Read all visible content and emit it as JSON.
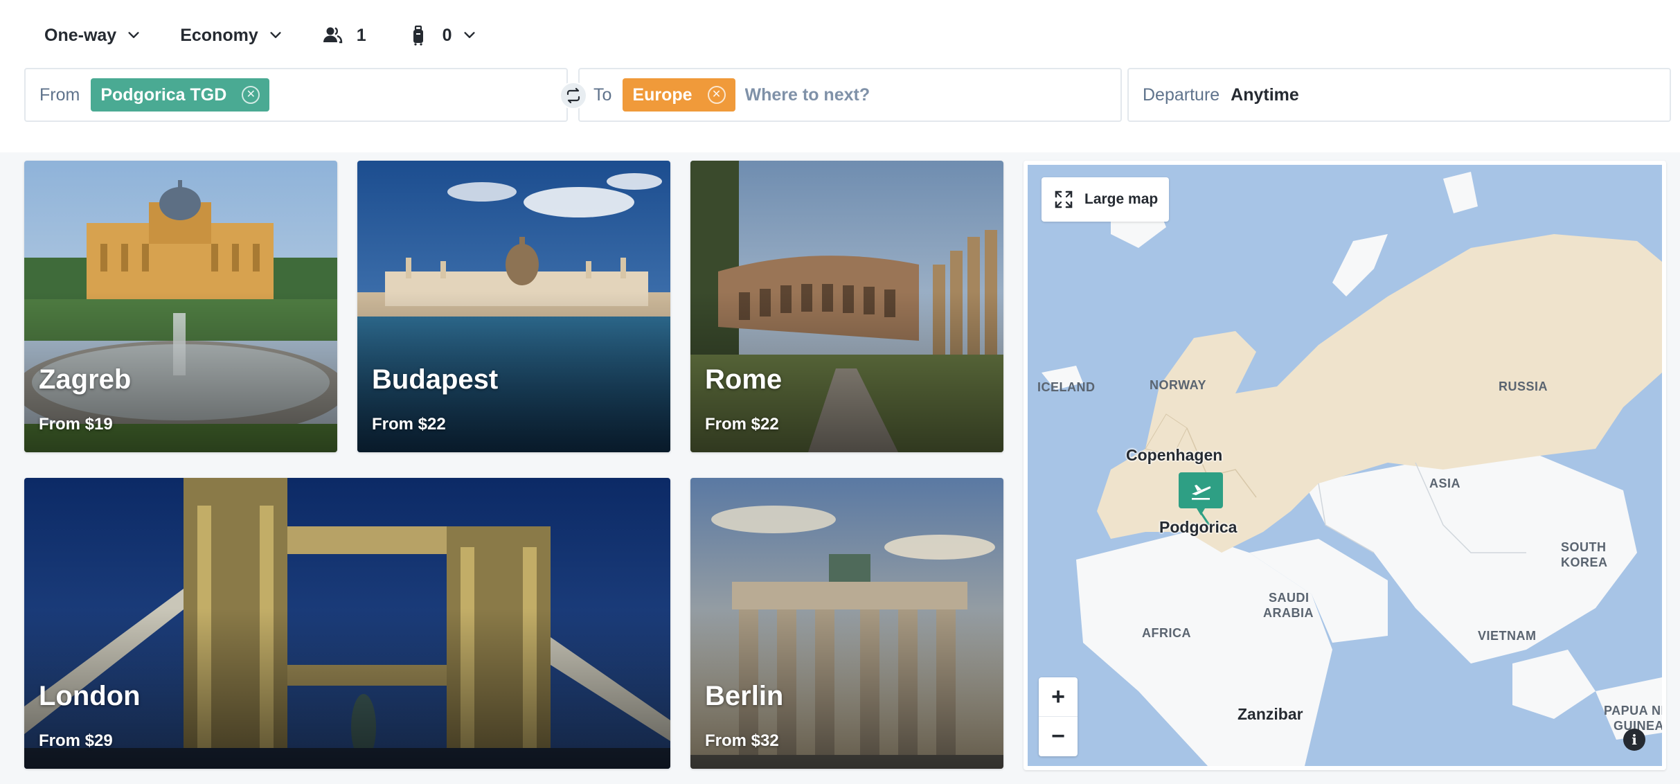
{
  "options": {
    "trip_type": "One-way",
    "cabin_class": "Economy",
    "passengers": "1",
    "bags": "0"
  },
  "search": {
    "from_label": "From",
    "from_chip": "Podgorica TGD",
    "to_label": "To",
    "to_chip": "Europe",
    "to_placeholder": "Where to next?",
    "departure_label": "Departure",
    "departure_value": "Anytime"
  },
  "destinations": [
    {
      "city": "Zagreb",
      "price": "From $19"
    },
    {
      "city": "Budapest",
      "price": "From $22"
    },
    {
      "city": "Rome",
      "price": "From $22"
    },
    {
      "city": "London",
      "price": "From $29"
    },
    {
      "city": "Berlin",
      "price": "From $32"
    }
  ],
  "map": {
    "large_map_label": "Large map",
    "zoom_in": "+",
    "zoom_out": "−",
    "info": "i",
    "labels": {
      "iceland": "ICELAND",
      "norway": "NORWAY",
      "russia": "RUSSIA",
      "copenhagen": "Copenhagen",
      "asia": "ASIA",
      "podgorica": "Podgorica",
      "south_korea_1": "SOUTH",
      "south_korea_2": "KOREA",
      "saudi_1": "SAUDI",
      "saudi_2": "ARABIA",
      "africa": "AFRICA",
      "vietnam": "VIETNAM",
      "zanzibar": "Zanzibar",
      "papua_1": "PAPUA NE",
      "papua_2": "GUINEA"
    },
    "colors": {
      "water": "#a7c4e6",
      "europe": "#efe3cc",
      "land": "#f7f8f9",
      "pin": "#2e9f84"
    }
  },
  "colors": {
    "chip_from": "#4aaa93",
    "chip_to": "#f09a3a"
  }
}
